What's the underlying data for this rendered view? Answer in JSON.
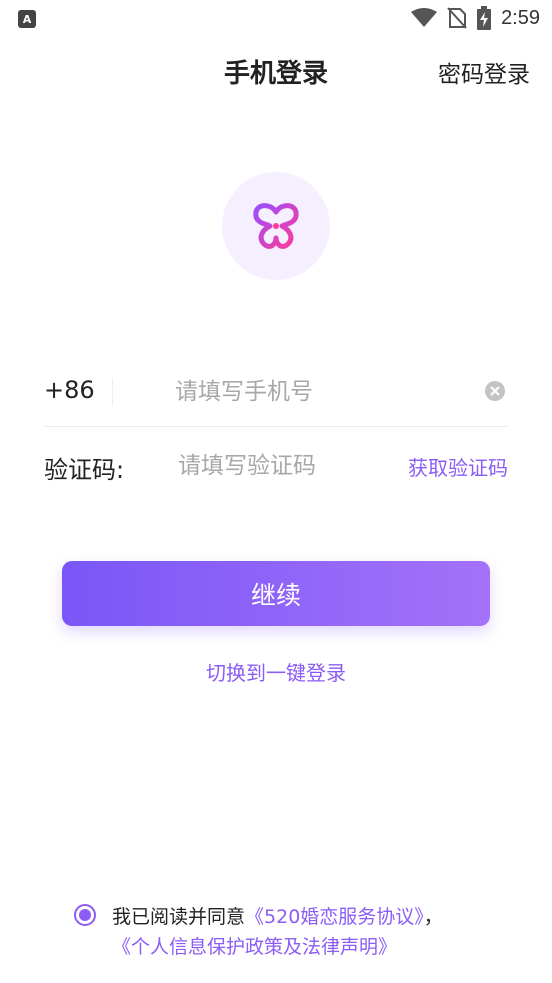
{
  "status_bar": {
    "time": "2:59",
    "app_icon_letter": "A"
  },
  "header": {
    "title": "手机登录",
    "password_login": "密码登录"
  },
  "form": {
    "country_code": "+86",
    "phone_placeholder": "请填写手机号",
    "code_label": "验证码:",
    "code_placeholder": "请填写验证码",
    "get_code": "获取验证码"
  },
  "continue_label": "继续",
  "switch_label": "切换到一键登录",
  "agreement": {
    "prefix": "我已阅读并同意",
    "service": "《520婚恋服务协议》",
    "comma": "，",
    "privacy": "《个人信息保护政策及法律声明》"
  },
  "colors": {
    "accent": "#8b5cf6",
    "gradient_start": "#7a56f8",
    "gradient_end": "#a472f8"
  }
}
